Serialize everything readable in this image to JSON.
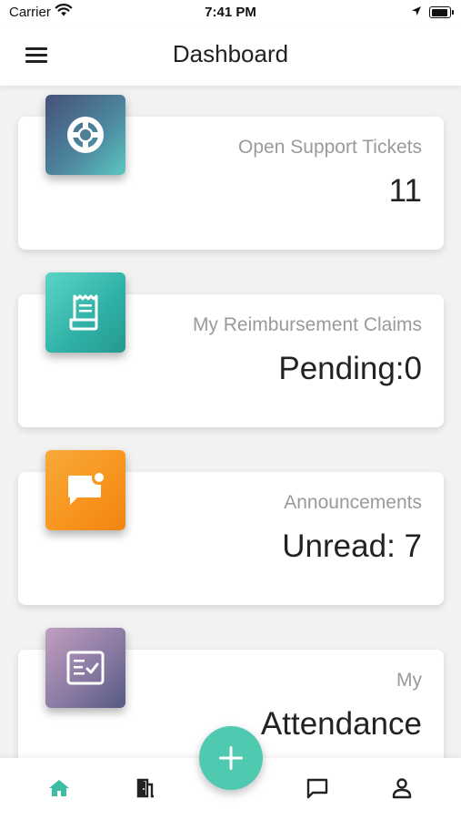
{
  "status_bar": {
    "carrier": "Carrier",
    "time": "7:41 PM"
  },
  "header": {
    "title": "Dashboard"
  },
  "cards": [
    {
      "label": "Open Support Tickets",
      "value": "11",
      "icon": "lifebuoy-icon",
      "color": "#4a5a82"
    },
    {
      "label": "My Reimbursement Claims",
      "value": "Pending:0",
      "icon": "receipt-icon",
      "color": "#2eb3a8"
    },
    {
      "label": "Announcements",
      "value": "Unread: 7",
      "icon": "announcement-icon",
      "color": "#f7941d"
    },
    {
      "label": "My",
      "value": "Attendance",
      "icon": "checklist-icon",
      "color": "#6b5b86"
    }
  ],
  "tabs": [
    {
      "name": "home",
      "icon": "home-icon",
      "active": true
    },
    {
      "name": "exit",
      "icon": "door-exit-icon",
      "active": false
    },
    {
      "name": "messages",
      "icon": "chat-icon",
      "active": false
    },
    {
      "name": "profile",
      "icon": "person-icon",
      "active": false
    }
  ],
  "fab": {
    "icon": "plus-icon"
  },
  "colors": {
    "accent": "#4fc9b0",
    "active_tab": "#3dbda3",
    "inactive_tab": "#222222"
  }
}
